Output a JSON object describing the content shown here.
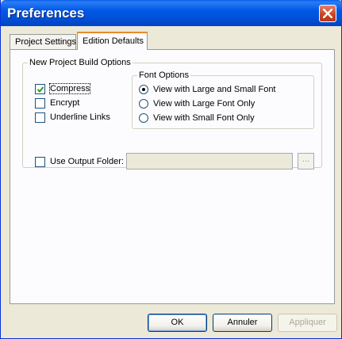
{
  "window": {
    "title": "Preferences"
  },
  "tabs": [
    {
      "label": "Project Settings",
      "active": false
    },
    {
      "label": "Edition Defaults",
      "active": true
    }
  ],
  "build_options": {
    "legend": "New Project Build Options",
    "checkboxes": [
      {
        "label": "Compress",
        "checked": true
      },
      {
        "label": "Encrypt",
        "checked": false
      },
      {
        "label": "Underline Links",
        "checked": false
      }
    ],
    "font_options": {
      "legend": "Font Options",
      "radios": [
        {
          "label": "View with Large and Small Font",
          "selected": true
        },
        {
          "label": "View with Large Font Only",
          "selected": false
        },
        {
          "label": "View with Small Font Only",
          "selected": false
        }
      ]
    },
    "output_folder": {
      "label": "Use Output Folder:",
      "checked": false,
      "value": "",
      "browse_label": "..."
    }
  },
  "buttons": {
    "ok": "OK",
    "cancel": "Annuler",
    "apply": "Appliquer"
  },
  "colors": {
    "title_bar": "#0058e6",
    "close_button": "#c9421e",
    "tab_active_accent": "#e68b2c",
    "window_background": "#ece9d8"
  }
}
